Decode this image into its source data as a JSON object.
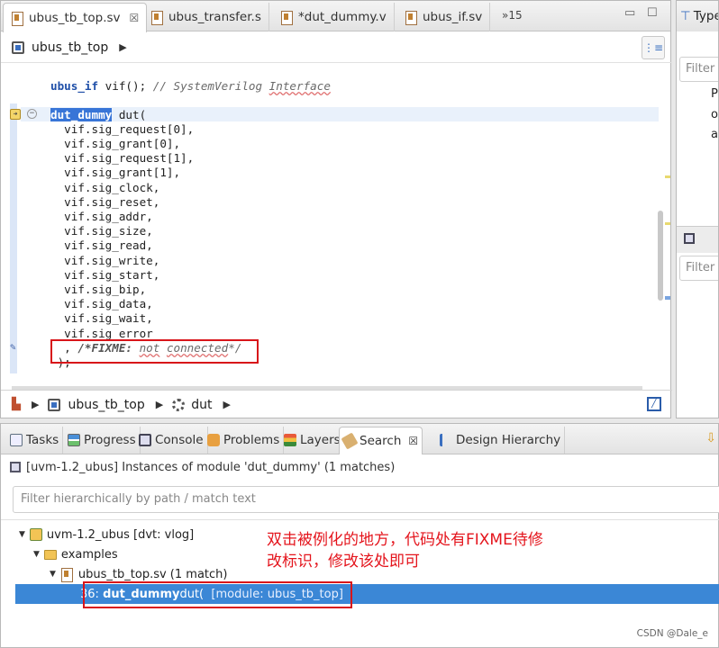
{
  "editor": {
    "tabs": [
      {
        "label": "ubus_tb_top.sv",
        "active": true,
        "close": "☒"
      },
      {
        "label": "ubus_transfer.s"
      },
      {
        "label": "*dut_dummy.v"
      },
      {
        "label": "ubus_if.sv"
      }
    ],
    "tab_overflow": "»15",
    "minimize": "▭",
    "maximize": "☐",
    "breadcrumb_top": "ubus_tb_top",
    "code_lines": [
      {
        "kw": "ubus_if",
        "rest": " vif(); ",
        "comment": "// SystemVerilog ",
        "comment_u": "Interface"
      },
      {
        "sel": "dut_dummy",
        "rest": " dut("
      },
      {
        "text": "  vif.sig_request[0],"
      },
      {
        "text": "  vif.sig_grant[0],"
      },
      {
        "text": "  vif.sig_request[1],"
      },
      {
        "text": "  vif.sig_grant[1],"
      },
      {
        "text": "  vif.sig_clock,"
      },
      {
        "text": "  vif.sig_reset,"
      },
      {
        "text": "  vif.sig_addr,"
      },
      {
        "text": "  vif.sig_size,"
      },
      {
        "text": "  vif.sig_read,"
      },
      {
        "text": "  vif.sig_write,"
      },
      {
        "text": "  vif.sig_start,"
      },
      {
        "text": "  vif.sig_bip,"
      },
      {
        "text": "  vif.sig_data,"
      },
      {
        "text": "  vif.sig_wait,"
      },
      {
        "text": "  vif.sig_error"
      },
      {
        "pre": "  , ",
        "c1": "/*FIXME: ",
        "cu1": "not",
        "c2": " ",
        "cu2": "connected",
        "c3": "*/"
      },
      {
        "text": " );"
      }
    ],
    "breadcrumb_bottom": [
      "ubus_tb_top",
      "dut"
    ]
  },
  "right_panel": {
    "title": "Type",
    "filter_top": "Filter l",
    "text_lines": [
      "Pl",
      "or",
      "ar"
    ],
    "filter_bottom": "Filter l"
  },
  "bottom": {
    "tabs": [
      {
        "label": "Tasks",
        "icon": "tasks-icon"
      },
      {
        "label": "Progress",
        "icon": "progress-icon"
      },
      {
        "label": "Console",
        "icon": "console-icon"
      },
      {
        "label": "Problems",
        "icon": "problems-icon"
      },
      {
        "label": "Layers",
        "icon": "layers-icon"
      },
      {
        "label": "Search",
        "icon": "search-icon",
        "active": true,
        "close": "☒"
      },
      {
        "label": "Design Hierarchy",
        "icon": "hierarchy-icon"
      }
    ],
    "summary": "[uvm-1.2_ubus] Instances of module 'dut_dummy' (1 matches)",
    "filter_placeholder": "Filter hierarchically by path / match text",
    "tree": {
      "project": "uvm-1.2_ubus [dvt: vlog]",
      "folder": "examples",
      "file": "ubus_tb_top.sv (1 match)",
      "match_line": "36:",
      "match_name": "dut_dummy",
      "match_rest": " dut(",
      "match_module": "[module: ubus_tb_top]"
    }
  },
  "annotation": {
    "line1": "双击被例化的地方，代码处有FIXME待修",
    "line2": "改标识，修改该处即可"
  },
  "watermark": "CSDN @Dale_e",
  "colors": {
    "selection": "#3b87d6",
    "keyword": "#1f4fa8",
    "annotation": "#e4141c"
  }
}
